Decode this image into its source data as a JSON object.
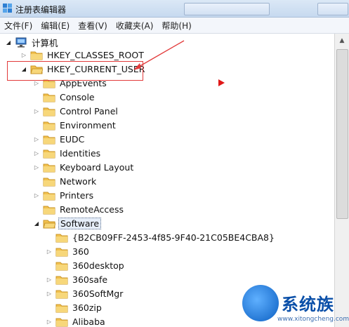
{
  "window": {
    "title": "注册表编辑器"
  },
  "menu": [
    {
      "label": "文件(F)"
    },
    {
      "label": "编辑(E)"
    },
    {
      "label": "查看(V)"
    },
    {
      "label": "收藏夹(A)"
    },
    {
      "label": "帮助(H)"
    }
  ],
  "tree": {
    "root": "计算机",
    "items": [
      {
        "label": "HKEY_CLASSES_ROOT"
      },
      {
        "label": "HKEY_CURRENT_USER"
      },
      {
        "label": "AppEvents"
      },
      {
        "label": "Console"
      },
      {
        "label": "Control Panel"
      },
      {
        "label": "Environment"
      },
      {
        "label": "EUDC"
      },
      {
        "label": "Identities"
      },
      {
        "label": "Keyboard Layout"
      },
      {
        "label": "Network"
      },
      {
        "label": "Printers"
      },
      {
        "label": "RemoteAccess"
      },
      {
        "label": "Software"
      },
      {
        "label": "{B2CB09FF-2453-4f85-9F40-21C05BE4CBA8}"
      },
      {
        "label": "360"
      },
      {
        "label": "360desktop"
      },
      {
        "label": "360safe"
      },
      {
        "label": "360SoftMgr"
      },
      {
        "label": "360zip"
      },
      {
        "label": "Alibaba"
      }
    ]
  },
  "watermark": {
    "brand": "系统族",
    "url": "www.xitongcheng.com"
  },
  "colors": {
    "annotation": "#e23a3a",
    "folder": "#f2c14e",
    "selection_bg": "#e6eef9"
  }
}
